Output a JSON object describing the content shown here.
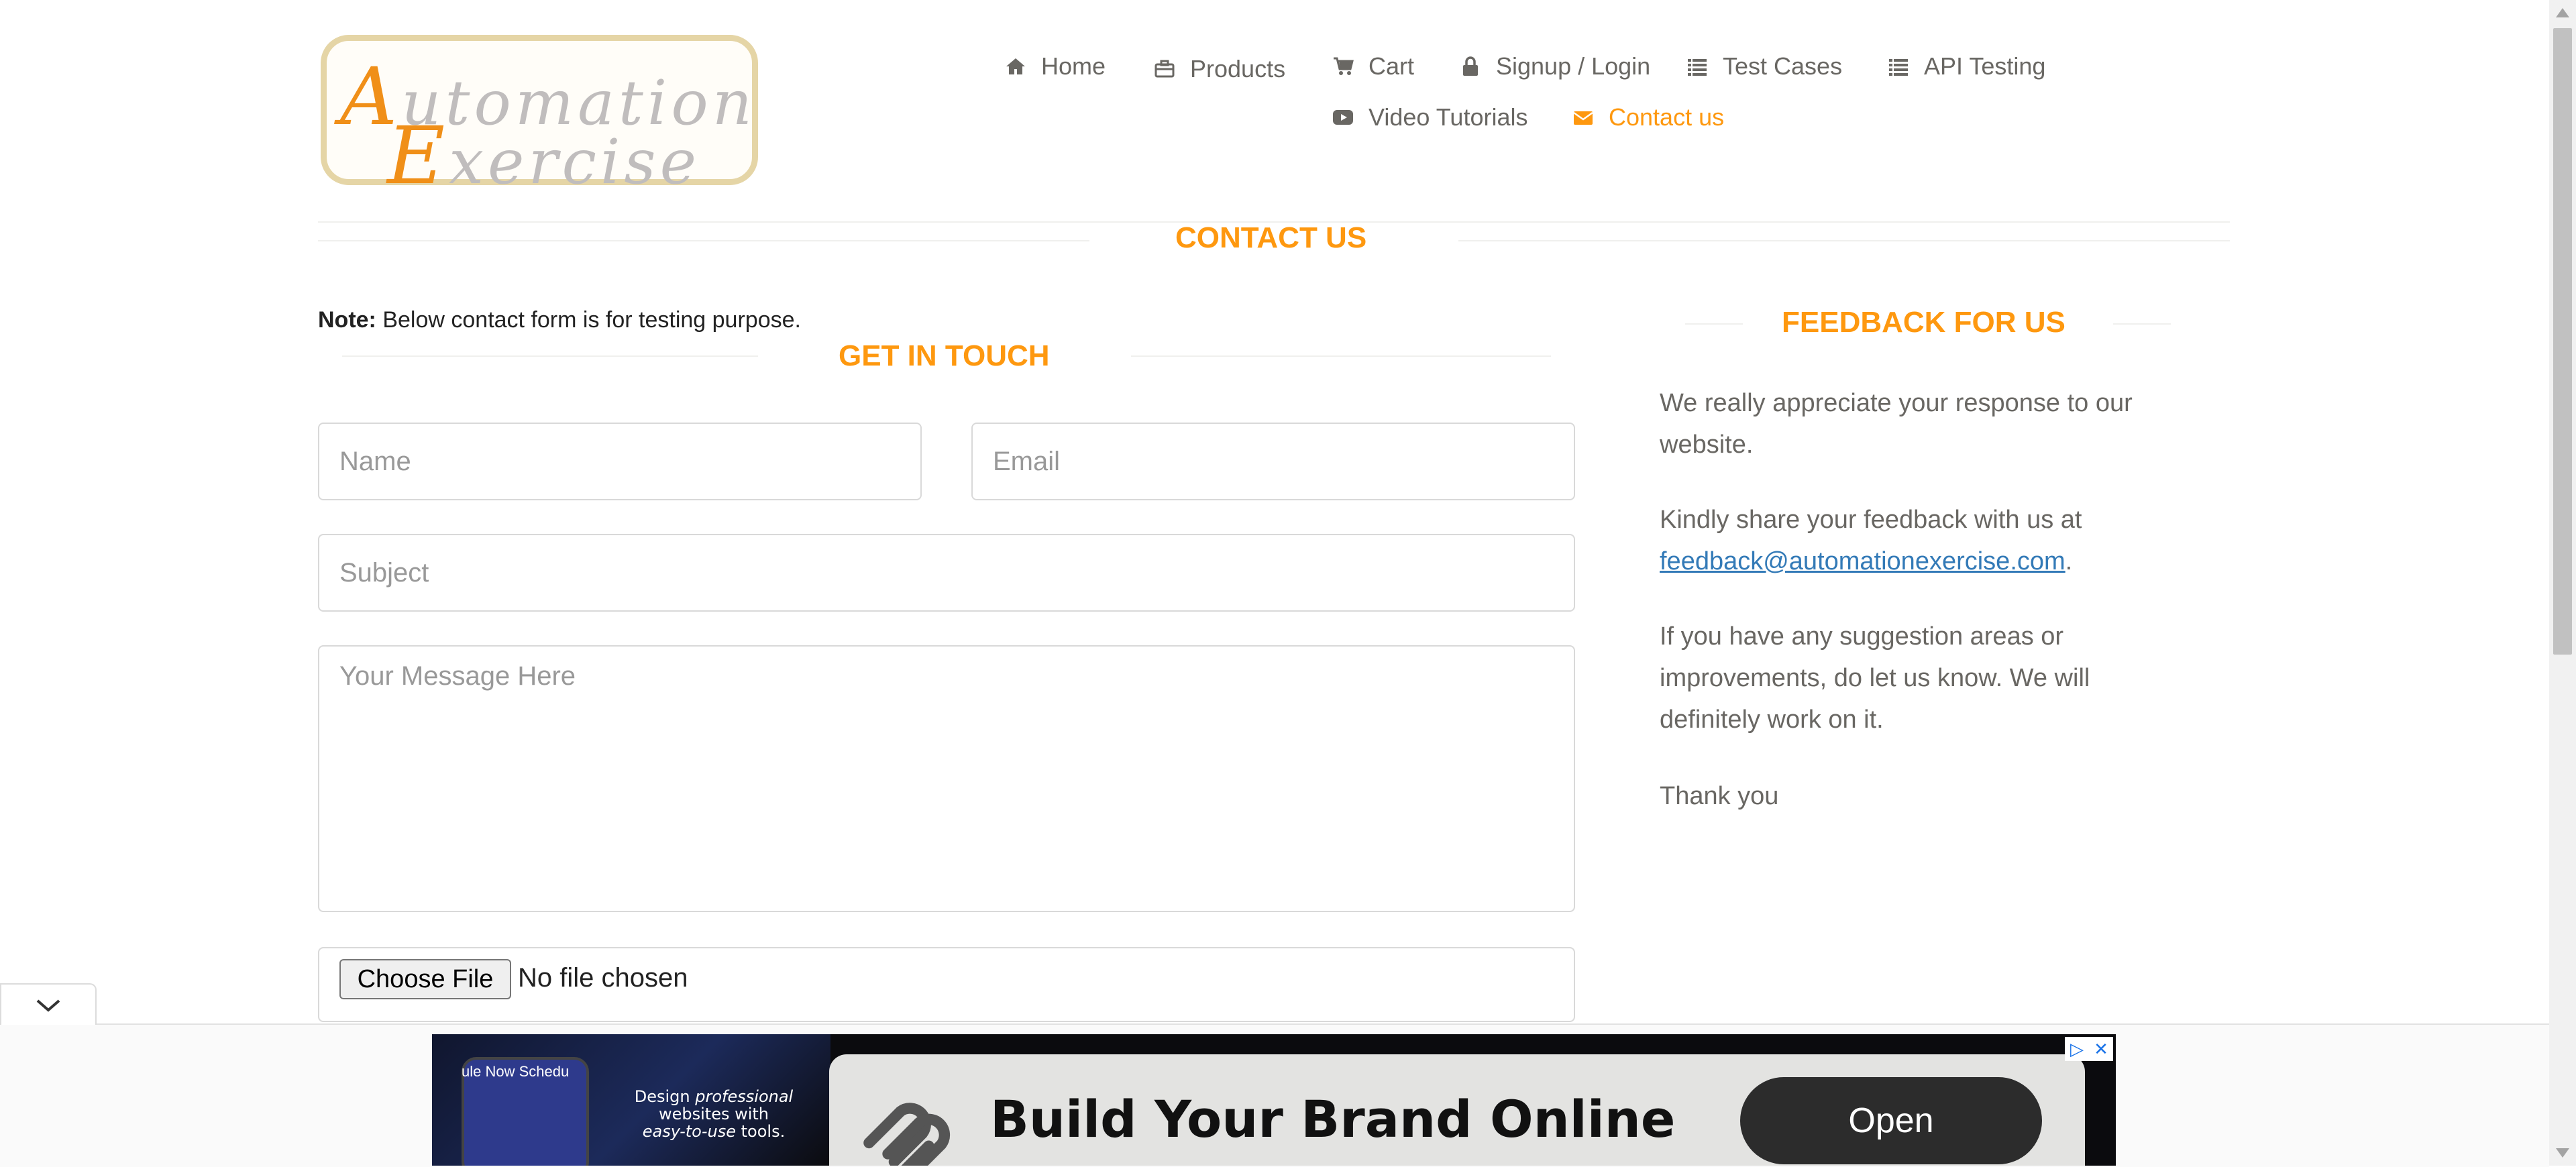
{
  "logo": {
    "line1_cap": "A",
    "line1_rest": "utomation",
    "line2_cap": "E",
    "line2_rest": "xercise"
  },
  "nav": {
    "home": "Home",
    "products": "Products",
    "cart": "Cart",
    "signup_login": "Signup / Login",
    "test_cases": "Test Cases",
    "api_testing": "API Testing",
    "video_tutorials": "Video Tutorials",
    "contact_us": "Contact us"
  },
  "contact_title": "CONTACT US",
  "note": {
    "label": "Note:",
    "text": " Below contact form is for testing purpose."
  },
  "form": {
    "title": "GET IN TOUCH",
    "name_placeholder": "Name",
    "email_placeholder": "Email",
    "subject_placeholder": "Subject",
    "message_placeholder": "Your Message Here",
    "file_button": "Choose File",
    "file_status": "No file chosen"
  },
  "feedback": {
    "title": "FEEDBACK FOR US",
    "p1": "We really appreciate your response to our website.",
    "p2_prefix": "Kindly share your feedback with us at",
    "email": "feedback@automationexercise.com",
    "p2_suffix": ".",
    "p3": "If you have any suggestion areas or improvements, do let us know. We will definitely work on it.",
    "p4": "Thank you"
  },
  "ad": {
    "phone_text": "ule Now    Schedu",
    "design_line1": "Design ",
    "design_em1": "professional",
    "design_line2": "websites with",
    "design_em2": "easy-to-use",
    "design_line3": " tools.",
    "headline": "Build Your Brand Online",
    "open_button": "Open"
  },
  "colors": {
    "accent": "#fe980f",
    "text": "#696763",
    "link": "#337ab7"
  }
}
